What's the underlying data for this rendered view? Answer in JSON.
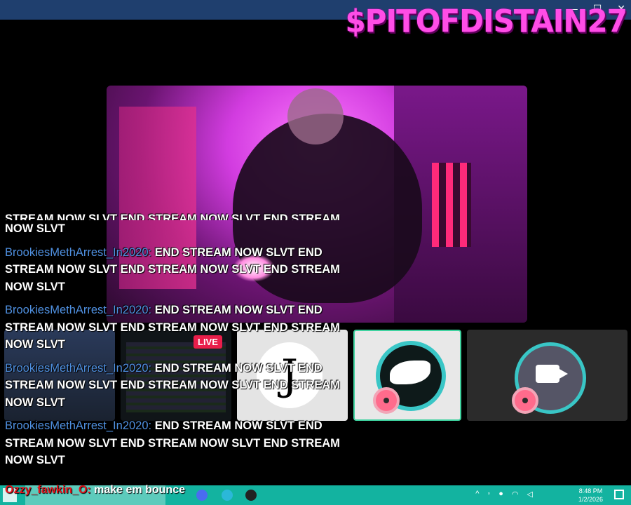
{
  "window": {
    "controls": [
      "—",
      "☐",
      "✕"
    ]
  },
  "stream": {
    "channel_name": "$PITOFDISTAIN27"
  },
  "tiles": [
    {
      "name": "tile-blurred"
    },
    {
      "name": "tile-screen",
      "badge": "LIVE"
    },
    {
      "name": "tile-logo-j",
      "glyph": "J"
    },
    {
      "name": "tile-shark"
    },
    {
      "name": "tile-camera"
    }
  ],
  "chat": {
    "partial_top_line1": "STREAM NOW SLVT END STREAM NOW SLVT END STREAM",
    "partial_top_line2": "NOW SLVT",
    "messages": [
      {
        "user": "BrookiesMethArrest_In2020:",
        "text": "END STREAM NOW SLVT END STREAM NOW SLVT END STREAM NOW SLVT END STREAM NOW SLVT"
      },
      {
        "user": "BrookiesMethArrest_In2020:",
        "text": "END STREAM NOW SLVT END STREAM NOW SLVT END STREAM NOW SLVT END STREAM NOW SLVT"
      },
      {
        "user": "BrookiesMethArrest_In2020:",
        "text": "END STREAM NOW SLVT END STREAM NOW SLVT END STREAM NOW SLVT END STREAM NOW SLVT"
      },
      {
        "user": "BrookiesMethArrest_In2020:",
        "text": "END STREAM NOW SLVT END STREAM NOW SLVT END STREAM NOW SLVT END STREAM NOW SLVT"
      }
    ],
    "bottom": {
      "user": "Ozzy_fawkin_O:",
      "text": "make em bounce"
    }
  },
  "taskbar": {
    "time": "8:48 PM",
    "date": "1/2/2026"
  },
  "colors": {
    "accent": "#ff4de6",
    "username": "#4f90e0",
    "taskbar": "#13b3a0"
  }
}
